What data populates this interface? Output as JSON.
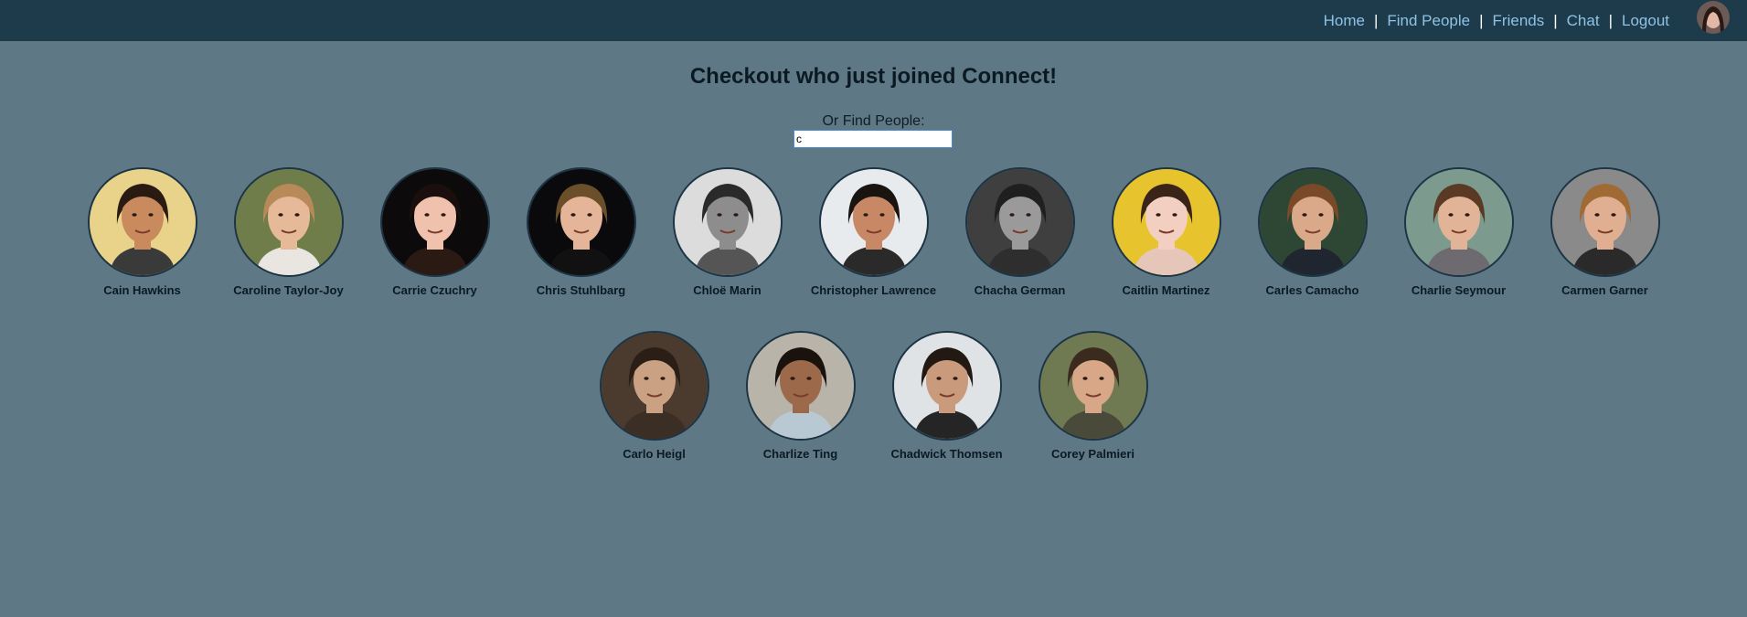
{
  "nav": {
    "links": [
      {
        "label": "Home"
      },
      {
        "label": "Find People"
      },
      {
        "label": "Friends"
      },
      {
        "label": "Chat"
      },
      {
        "label": "Logout"
      }
    ],
    "separator": "|",
    "avatar_icon": "user-avatar"
  },
  "main": {
    "title": "Checkout who just joined Connect!",
    "find_label": "Or Find People:",
    "search_value": "c"
  },
  "people": [
    {
      "name": "Cain Hawkins",
      "bg": "#e9d28a",
      "skin": "#c98b5e",
      "hair": "#2a1b12",
      "shirt": "#3a3a3a"
    },
    {
      "name": "Caroline Taylor-Joy",
      "bg": "#6f7d4a",
      "skin": "#e6b999",
      "hair": "#b88a5a",
      "shirt": "#e9e6e2"
    },
    {
      "name": "Carrie Czuchry",
      "bg": "#0c0a0a",
      "skin": "#f0c2ad",
      "hair": "#1a0f0d",
      "shirt": "#2b1a14"
    },
    {
      "name": "Chris Stuhlbarg",
      "bg": "#0a0a0c",
      "skin": "#e5b59a",
      "hair": "#6b4e2a",
      "shirt": "#111111"
    },
    {
      "name": "Chloë Marin",
      "bg": "#dcdcdc",
      "skin": "#8d8d8d",
      "hair": "#2a2a2a",
      "shirt": "#555555"
    },
    {
      "name": "Christopher Lawrence",
      "bg": "#e8ebee",
      "skin": "#c98865",
      "hair": "#1a1411",
      "shirt": "#2a2a2a"
    },
    {
      "name": "Chacha German",
      "bg": "#3f3f3f",
      "skin": "#9a9a9a",
      "hair": "#1f1f1f",
      "shirt": "#2e2e2e"
    },
    {
      "name": "Caitlin Martinez",
      "bg": "#e7c42d",
      "skin": "#f2cfc0",
      "hair": "#3a2418",
      "shirt": "#e6c6b8"
    },
    {
      "name": "Carles Camacho",
      "bg": "#2e4634",
      "skin": "#d9a98a",
      "hair": "#7a4a28",
      "shirt": "#1f2630"
    },
    {
      "name": "Charlie Seymour",
      "bg": "#7c9a8e",
      "skin": "#e2b497",
      "hair": "#5a3a24",
      "shirt": "#6d6a70"
    },
    {
      "name": "Carmen Garner",
      "bg": "#8a8a8a",
      "skin": "#e0ae90",
      "hair": "#a06a34",
      "shirt": "#2a2a2a"
    },
    {
      "name": "Carlo Heigl",
      "bg": "#4a3b2e",
      "skin": "#caa182",
      "hair": "#2a1e16",
      "shirt": "#3b2e24"
    },
    {
      "name": "Charlize Ting",
      "bg": "#b8b4aa",
      "skin": "#9c6a4a",
      "hair": "#1a120d",
      "shirt": "#b9c9d4"
    },
    {
      "name": "Chadwick Thomsen",
      "bg": "#dfe3e6",
      "skin": "#c99a7c",
      "hair": "#231913",
      "shirt": "#252525"
    },
    {
      "name": "Corey Palmieri",
      "bg": "#6f7a52",
      "skin": "#d8a787",
      "hair": "#3b2b1f",
      "shirt": "#4a4a3a"
    }
  ]
}
